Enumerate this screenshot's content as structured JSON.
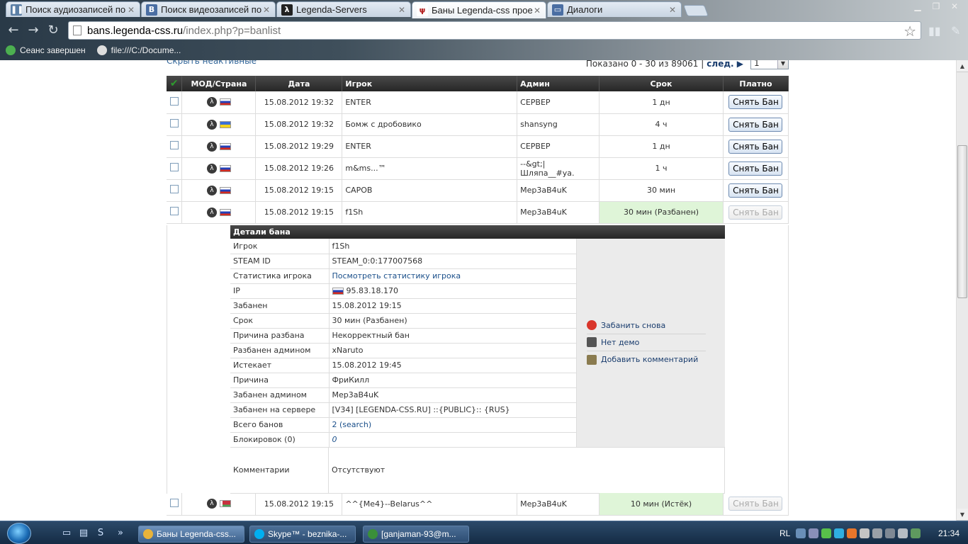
{
  "browser": {
    "tabs": [
      {
        "title": "Поиск аудиозаписей по",
        "favicon_color": "#5b7fa6",
        "glyph": "❚❚",
        "active": false
      },
      {
        "title": "Поиск видеозаписей по",
        "favicon_color": "#4a6ea3",
        "glyph": "B",
        "active": false
      },
      {
        "title": "Legenda-Servers",
        "favicon_color": "#222222",
        "glyph": "λ",
        "active": false
      },
      {
        "title": "Баны Legenda-css прое",
        "favicon_color": "#ffffff",
        "glyph": "ψ",
        "active": true
      },
      {
        "title": "Диалоги",
        "favicon_color": "#4a6ea3",
        "glyph": "▭",
        "active": false
      }
    ],
    "url_host": "bans.legenda-css.ru",
    "url_path": "/index.php?p=banlist",
    "bookmarks": [
      {
        "label": "Сеанс завершен",
        "icon_color": "#4caf50"
      },
      {
        "label": "file:///C:/Docume...",
        "icon_color": "#dddddd"
      }
    ]
  },
  "page": {
    "hide_inactive": "Скрыть неактивные",
    "pager_text": "Показано 0 - 30 из 89061 |",
    "pager_next": "след. ▶",
    "pager_select": "1",
    "columns": [
      "МОД/Страна",
      "Дата",
      "Игрок",
      "Админ",
      "Срок",
      "Платно"
    ],
    "rows": [
      {
        "flag": "ru",
        "date": "15.08.2012 19:32",
        "player": "ENTER",
        "admin": "СЕРВЕР",
        "term": "1 дн",
        "button": "Снять Бан",
        "unbanned": false
      },
      {
        "flag": "ua",
        "date": "15.08.2012 19:32",
        "player": "Бомж с дробовико",
        "admin": "shansyng",
        "term": "4 ч",
        "button": "Снять Бан",
        "unbanned": false
      },
      {
        "flag": "ru",
        "date": "15.08.2012 19:29",
        "player": "ENTER",
        "admin": "СЕРВЕР",
        "term": "1 дн",
        "button": "Снять Бан",
        "unbanned": false
      },
      {
        "flag": "ru",
        "date": "15.08.2012 19:26",
        "player": "m&ms...™",
        "admin": "--&gt;|\nШляпа__#ya.",
        "term": "1 ч",
        "button": "Снять Бан",
        "unbanned": false
      },
      {
        "flag": "ru",
        "date": "15.08.2012 19:15",
        "player": "САРОВ",
        "admin": "Мер3аВ4uK",
        "term": "30 мин",
        "button": "Снять Бан",
        "unbanned": false
      },
      {
        "flag": "ru",
        "date": "15.08.2012 19:15",
        "player": "f1Sh",
        "admin": "Мер3аВ4uK",
        "term": "30 мин (Разбанен)",
        "button": "Снять Бан",
        "unbanned": true
      }
    ],
    "details": {
      "title": "Детали бана",
      "fields": [
        {
          "label": "Игрок",
          "value": "f1Sh"
        },
        {
          "label": "STEAM ID",
          "value": "STEAM_0:0:177007568"
        },
        {
          "label": "Статистика игрока",
          "value": "Посмотреть статистику игрока",
          "link": true
        },
        {
          "label": "IP",
          "value": "95.83.18.170",
          "flag": true
        },
        {
          "label": "Забанен",
          "value": "15.08.2012 19:15"
        },
        {
          "label": "Срок",
          "value": "30 мин (Разбанен)"
        },
        {
          "label": "Причина разбана",
          "value": "Некорректный бан"
        },
        {
          "label": "Разбанен админом",
          "value": "xNaruto"
        },
        {
          "label": "Истекает",
          "value": "15.08.2012 19:45"
        },
        {
          "label": "Причина",
          "value": "ФриКилл"
        },
        {
          "label": "Забанен админом",
          "value": "Мер3аВ4uK"
        },
        {
          "label": "Забанен на сервере",
          "value": "[V34] [LEGENDA-CSS.RU] ::{PUBLIC}:: {RUS}"
        },
        {
          "label": "Всего банов",
          "value": "2 (search)",
          "link": true
        },
        {
          "label": "Блокировок (0)",
          "value": "0",
          "link": true
        }
      ],
      "actions": [
        {
          "label": "Забанить снова",
          "icon": "ban-icon",
          "color": "#d9362b"
        },
        {
          "label": "Нет демо",
          "icon": "demo-icon",
          "color": "#555555"
        },
        {
          "label": "Добавить комментарий",
          "icon": "comment-icon",
          "color": "#8a7b4f"
        }
      ],
      "comments_label": "Комментарии",
      "comments_value": "Отсутствуют"
    },
    "last_row": {
      "flag": "by",
      "date": "15.08.2012 19:15",
      "player": "^^{Me4}--Belarus^^",
      "admin": "Мер3аВ4uK",
      "term": "10 мин (Истёк)",
      "button": "Снять Бан"
    }
  },
  "taskbar": {
    "tasks": [
      {
        "label": "Баны Legenda-css...",
        "icon_color": "#e8b33a",
        "active": true
      },
      {
        "label": "Skype™ - beznika-...",
        "icon_color": "#00aff0",
        "active": false
      },
      {
        "label": "[ganjaman-93@m...",
        "icon_color": "#3a8f3a",
        "active": false
      }
    ],
    "lang": "RL",
    "clock": "21:34"
  }
}
